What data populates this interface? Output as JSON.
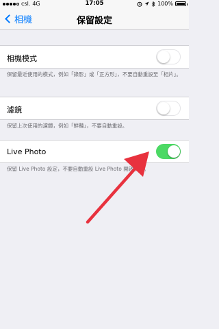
{
  "status_bar": {
    "carrier": "csl.",
    "network": "4G",
    "time": "17:05",
    "battery_percent": "100%",
    "battery_level": 1.0
  },
  "nav": {
    "back_label": "相機",
    "title": "保留設定"
  },
  "settings": [
    {
      "label": "相機模式",
      "on": false,
      "footer": "保留最近使用的模式，例如「錄影」或「正方形」，不要自動重設至「相片」。"
    },
    {
      "label": "濾鏡",
      "on": false,
      "footer": "保留上次使用的濾鏡，例如「鮮豔」，不要自動重設。"
    },
    {
      "label": "Live Photo",
      "on": true,
      "footer": "保留 Live Photo 設定，不要自動重設 Live Photo 開啟模式。"
    }
  ],
  "colors": {
    "accent": "#007aff",
    "toggle_on": "#4cd964",
    "annotation_arrow": "#e8323e",
    "background": "#efeff4"
  },
  "icons": [
    "chevron-left-icon",
    "alarm-icon",
    "location-arrow-icon",
    "bluetooth-icon",
    "battery-icon"
  ]
}
